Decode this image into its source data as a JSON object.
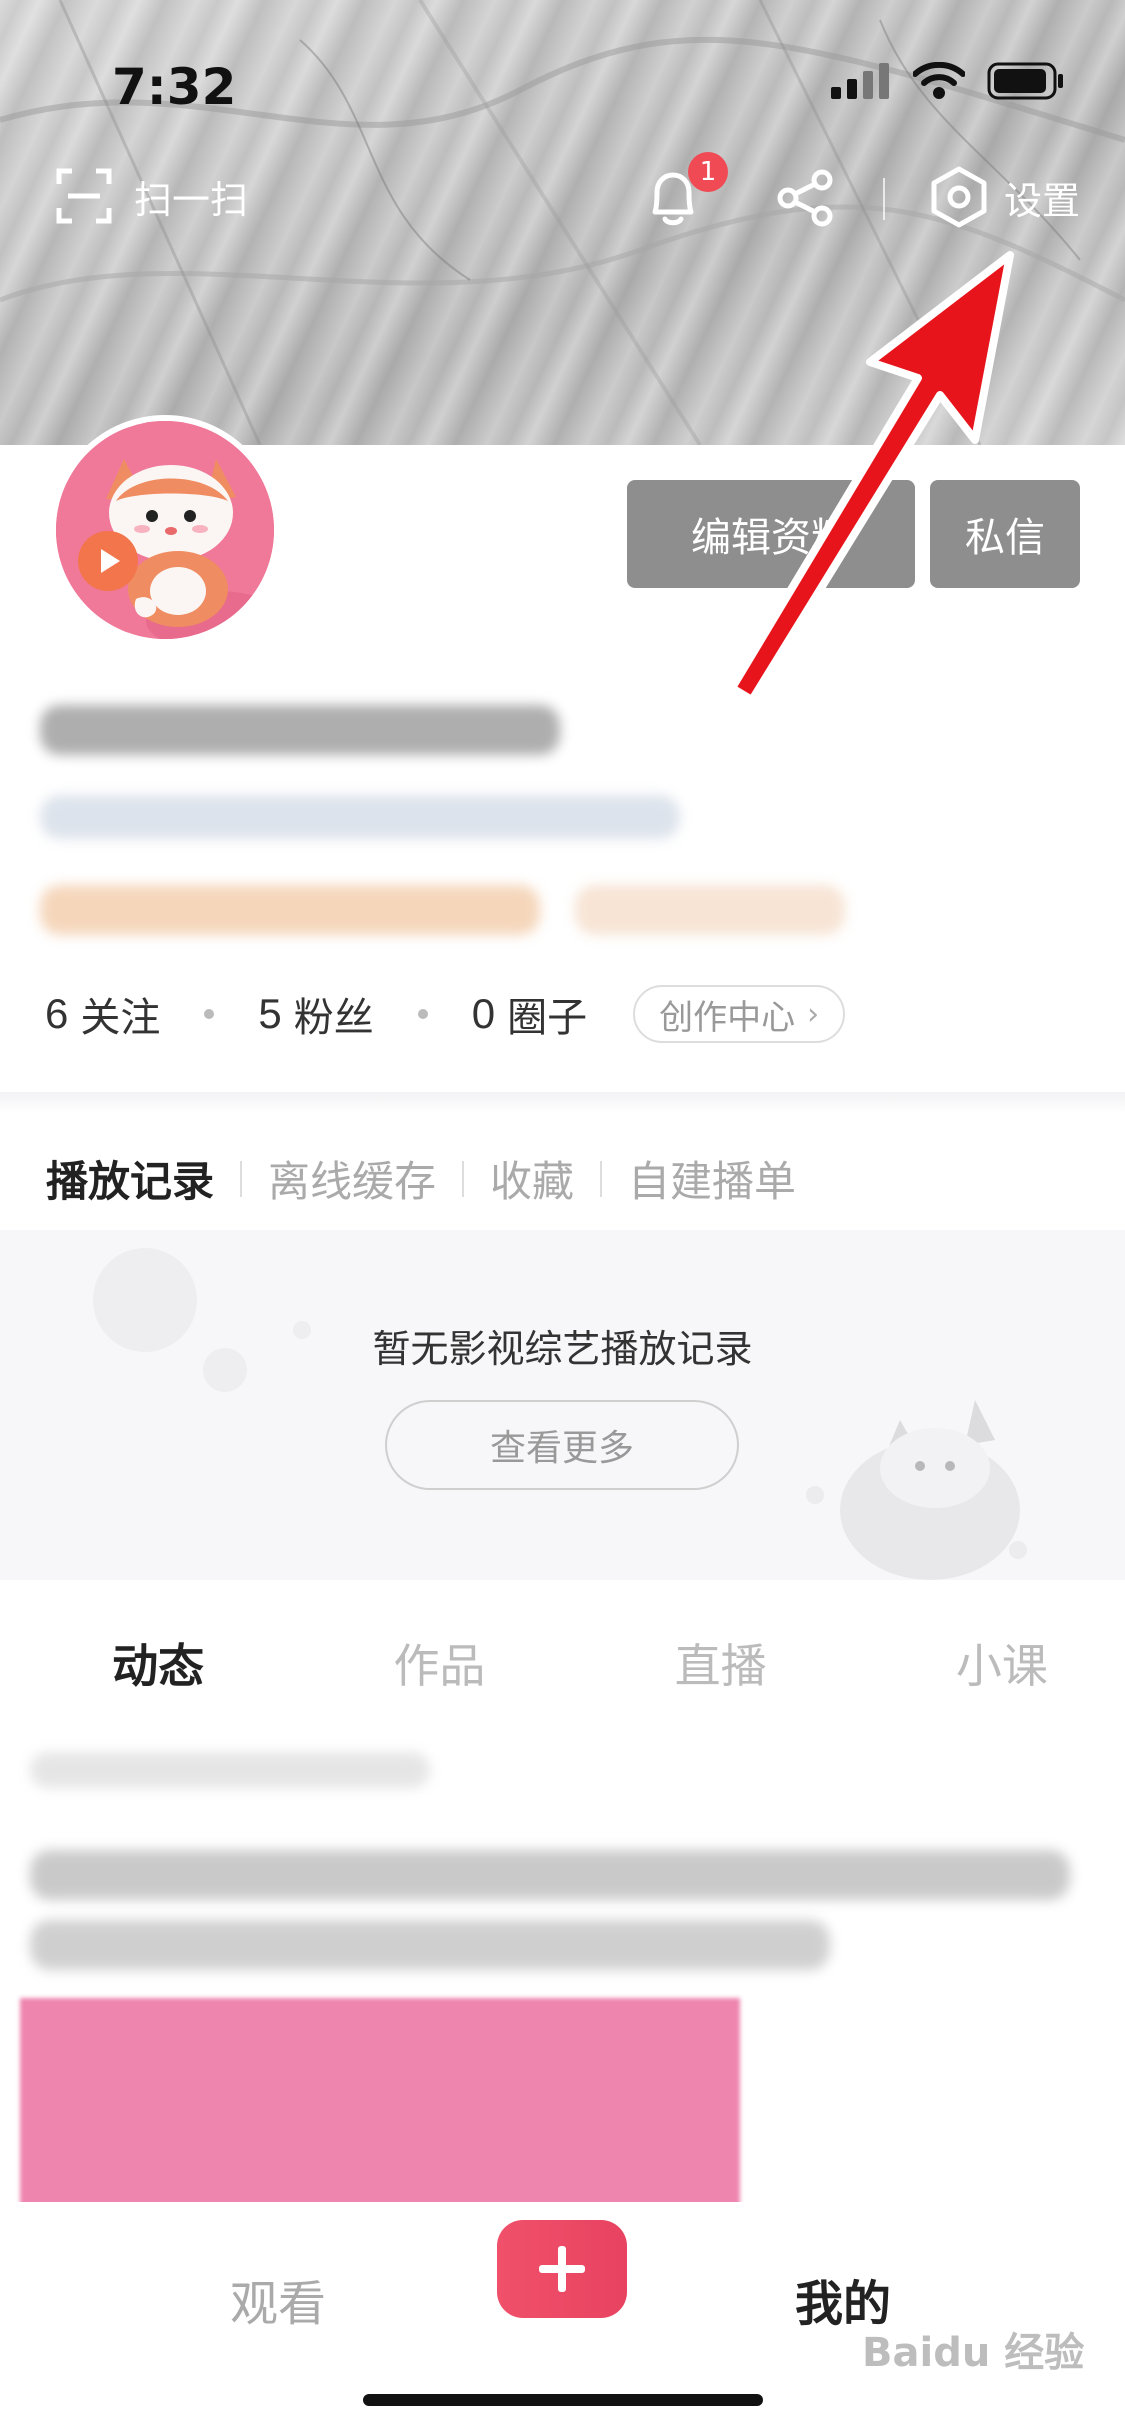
{
  "status_bar": {
    "time": "7:32"
  },
  "top_bar": {
    "scan_label": "扫一扫",
    "notification_count": "1",
    "settings_label": "设置"
  },
  "profile": {
    "edit_button": "编辑资料",
    "message_button": "私信",
    "stats": [
      {
        "num": "6",
        "label": "关注"
      },
      {
        "num": "5",
        "label": "粉丝"
      },
      {
        "num": "0",
        "label": "圈子"
      }
    ],
    "creator_center": "创作中心"
  },
  "records": {
    "tabs": [
      "播放记录",
      "离线缓存",
      "收藏",
      "自建播单"
    ],
    "active_tab": 0,
    "empty_text": "暂无影视综艺播放记录",
    "view_more": "查看更多"
  },
  "content_tabs": [
    "动态",
    "作品",
    "直播",
    "小课"
  ],
  "bottom_nav": {
    "watch": "观看",
    "mine": "我的"
  },
  "watermark": "Baidu 经验",
  "colors": {
    "accent": "#e84361",
    "badge": "#f04a55",
    "annotation_arrow": "#e8141c",
    "button_gray": "#8e8e8e"
  }
}
